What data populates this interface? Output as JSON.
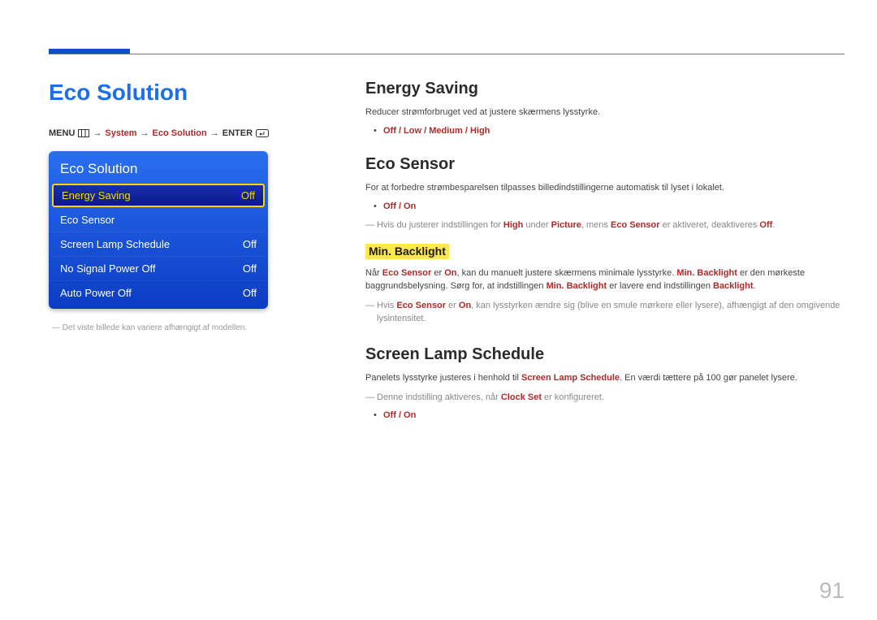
{
  "page_number": "91",
  "left": {
    "title": "Eco Solution",
    "breadcrumb": {
      "menu": "MENU",
      "arrow": "→",
      "system": "System",
      "eco": "Eco Solution",
      "enter": "ENTER"
    },
    "osd": {
      "title": "Eco Solution",
      "rows": [
        {
          "label": "Energy Saving",
          "value": "Off",
          "selected": true
        },
        {
          "label": "Eco Sensor",
          "value": "",
          "selected": false
        },
        {
          "label": "Screen Lamp Schedule",
          "value": "Off",
          "selected": false
        },
        {
          "label": "No Signal Power Off",
          "value": "Off",
          "selected": false
        },
        {
          "label": "Auto Power Off",
          "value": "Off",
          "selected": false
        }
      ]
    },
    "footnote": "Det viste billede kan variere afhængigt af modellen."
  },
  "right": {
    "energy_saving": {
      "heading": "Energy Saving",
      "desc": "Reducer strømforbruget ved at justere skærmens lysstyrke.",
      "options": "Off / Low / Medium / High"
    },
    "eco_sensor": {
      "heading": "Eco Sensor",
      "desc": "For at forbedre strømbesparelsen tilpasses billedindstillingerne automatisk til lyset i lokalet.",
      "options": "Off / On",
      "note_pre": "Hvis du justerer indstillingen for ",
      "note_high": "High",
      "note_mid1": " under ",
      "note_picture": "Picture",
      "note_mid2": ", mens ",
      "note_eco": "Eco Sensor",
      "note_mid3": " er aktiveret, deaktiveres ",
      "note_off": "Off",
      "note_end": "."
    },
    "min_backlight": {
      "heading": "Min. Backlight",
      "p1_pre": "Når ",
      "p1_eco": "Eco Sensor",
      "p1_mid1": " er ",
      "p1_on": "On",
      "p1_mid2": ", kan du manuelt justere skærmens minimale lysstyrke. ",
      "p1_mb": "Min. Backlight",
      "p1_mid3": " er den mørkeste baggrundsbelysning. Sørg for, at indstillingen ",
      "p1_mb2": "Min. Backlight",
      "p1_mid4": " er lavere end indstillingen ",
      "p1_bl": "Backlight",
      "p1_end": ".",
      "note_pre": "Hvis ",
      "note_eco": "Eco Sensor",
      "note_mid1": " er ",
      "note_on": "On",
      "note_rest": ", kan lysstyrken ændre sig (blive en smule mørkere eller lysere), afhængigt af den omgivende lysintensitet."
    },
    "screen_lamp": {
      "heading": "Screen Lamp Schedule",
      "p_pre": "Panelets lysstyrke justeres i henhold til ",
      "p_sls": "Screen Lamp Schedule",
      "p_post": ". En værdi tættere på 100 gør panelet lysere.",
      "note_pre": "Denne indstilling aktiveres, når ",
      "note_clock": "Clock Set",
      "note_post": " er konfigureret.",
      "options": "Off / On"
    }
  }
}
